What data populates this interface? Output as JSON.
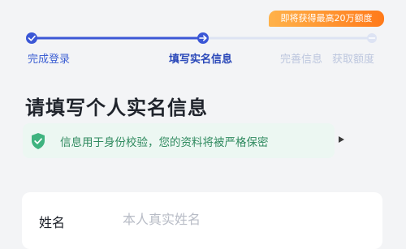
{
  "promo": {
    "text": "即将获得最高20万额度"
  },
  "steps": [
    {
      "label": "完成登录",
      "state": "done"
    },
    {
      "label": "填写实名信息",
      "state": "current"
    },
    {
      "label": "完善信息",
      "state": "todo"
    },
    {
      "label": "获取额度",
      "state": "todo"
    }
  ],
  "page": {
    "title": "请填写个人实名信息"
  },
  "notice": {
    "text": "信息用于身份校验，您的资料将被严格保密",
    "icon": "shield-check-icon",
    "action_icon": "play-triangle-icon"
  },
  "form": {
    "name_label": "姓名",
    "name_placeholder": "本人真实姓名",
    "name_value": ""
  },
  "colors": {
    "progress_done": "#3b57d6",
    "progress_todo": "#dde3f3",
    "notice_bg": "#ecf7f2",
    "notice_text": "#2f8a5f",
    "promo_start": "#ffb24a",
    "promo_end": "#ff7a1a"
  }
}
